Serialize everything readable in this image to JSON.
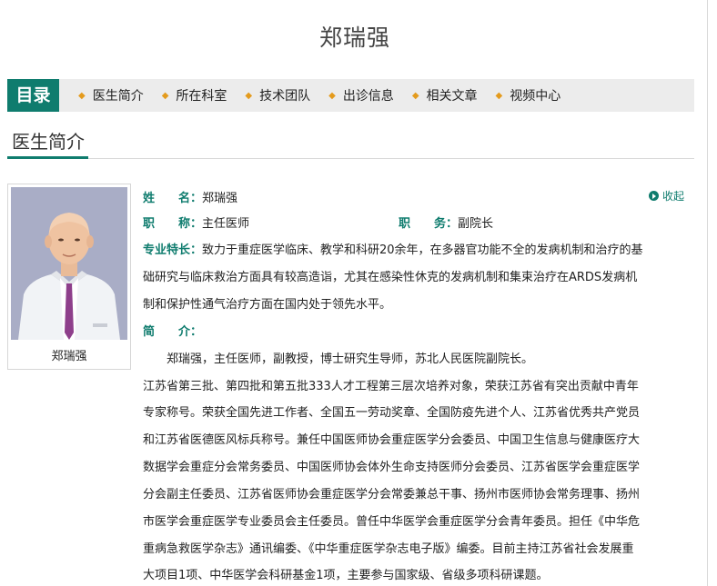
{
  "page": {
    "title": "郑瑞强"
  },
  "toc": {
    "label": "目录",
    "items": [
      "医生简介",
      "所在科室",
      "技术团队",
      "出诊信息",
      "相关文章",
      "视频中心"
    ]
  },
  "section": {
    "title": "医生简介"
  },
  "profile": {
    "photo_caption": "郑瑞强",
    "name_label": "姓　　名：",
    "name": "郑瑞强",
    "title_label": "职　　称：",
    "title": "主任医师",
    "position_label": "职　　务：",
    "position": "副院长",
    "specialty_label": "专业特长：",
    "specialty_lines": [
      "致力于重症医学临床、教学和科研20余年，在多器官功能不全的发病机制和治疗的基",
      "础研究与临床救治方面具有较高造诣，尤其在感染性休克的发病机制和集束治疗在ARDS发病机",
      "制和保护性通气治疗方面在国内处于领先水平。"
    ],
    "intro_label": "简　　介：",
    "intro_lines": [
      "　　郑瑞强，主任医师，副教授，博士研究生导师，苏北人民医院副院长。",
      "江苏省第三批、第四批和第五批333人才工程第三层次培养对象，荣获江苏省有突出贡献中青年",
      "专家称号。荣获全国先进工作者、全国五一劳动奖章、全国防疫先进个人、江苏省优秀共产党员",
      "和江苏省医德医风标兵称号。兼任中国医师协会重症医学分会委员、中国卫生信息与健康医疗大",
      "数据学会重症分会常务委员、中国医师协会体外生命支持医师分会委员、江苏省医学会重症医学",
      "分会副主任委员、江苏省医师协会重症医学分会常委兼总干事、扬州市医师协会常务理事、扬州",
      "市医学会重症医学专业委员会主任委员。曾任中华医学会重症医学分会青年委员。担任《中华危",
      "重病急救医学杂志》通讯编委、《中华重症医学杂志电子版》编委。目前主持江苏省社会发展重",
      "大项目1项、中华医学会科研基金1项，主要参与国家级、省级多项科研课题。"
    ],
    "collapse_label": "收起"
  },
  "colors": {
    "accent": "#0f7c6e",
    "bullet": "#e49b1d",
    "toc_bg": "#ececec"
  }
}
